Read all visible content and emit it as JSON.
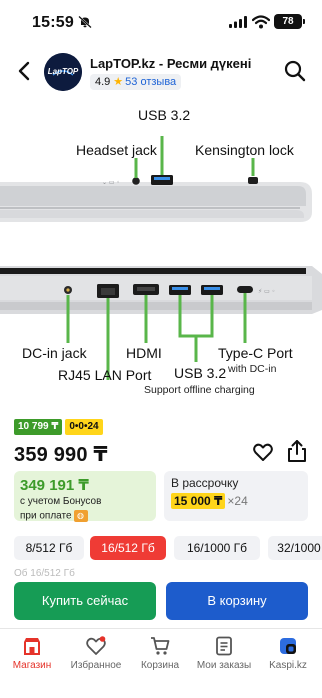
{
  "status_bar": {
    "time": "15:59",
    "battery": "78"
  },
  "header": {
    "store_name": "LapTOP.kz - Ресми дүкені",
    "rating": "4.9",
    "reviews": "53 отзыва",
    "logo_text": "LapTOP"
  },
  "image_labels": {
    "headset": "Headset jack",
    "usb_top": "USB 3.2",
    "kensington": "Kensington lock",
    "dc_in": "DC-in jack",
    "hdmi": "HDMI",
    "rj45": "RJ45 LAN Port",
    "usb_bottom": "USB 3.2",
    "type_c": "Type-C Port",
    "type_c_sub": "with DC-in",
    "offline_charging": "Support offline charging"
  },
  "badges": {
    "bonus": "10 799 ₸",
    "installment": "0•0•24"
  },
  "price": "359 990 ₸",
  "bonus_box": {
    "price": "349 191 ₸",
    "note_line1": "с учетом Бонусов",
    "note_line2": "при оплате"
  },
  "installment_box": {
    "label": "В рассрочку",
    "amount": "15 000 ₸",
    "months": "×24"
  },
  "variants": [
    "8/512 Гб",
    "16/512 Гб",
    "16/1000 Гб",
    "32/1000"
  ],
  "behind_text": "Об                16/512 Гб",
  "buttons": {
    "buy_now": "Купить сейчас",
    "add_to_cart": "В корзину"
  },
  "nav": {
    "store": "Магазин",
    "favorites": "Избранное",
    "cart": "Корзина",
    "orders": "Мои заказы",
    "kaspi": "Kaspi.kz"
  },
  "colors": {
    "accent_red": "#ef3b35",
    "buy_green": "#169c55",
    "cart_blue": "#1d5ccc",
    "bonus_green": "#3d9b2a",
    "highlight_yellow": "#ffd51a"
  }
}
